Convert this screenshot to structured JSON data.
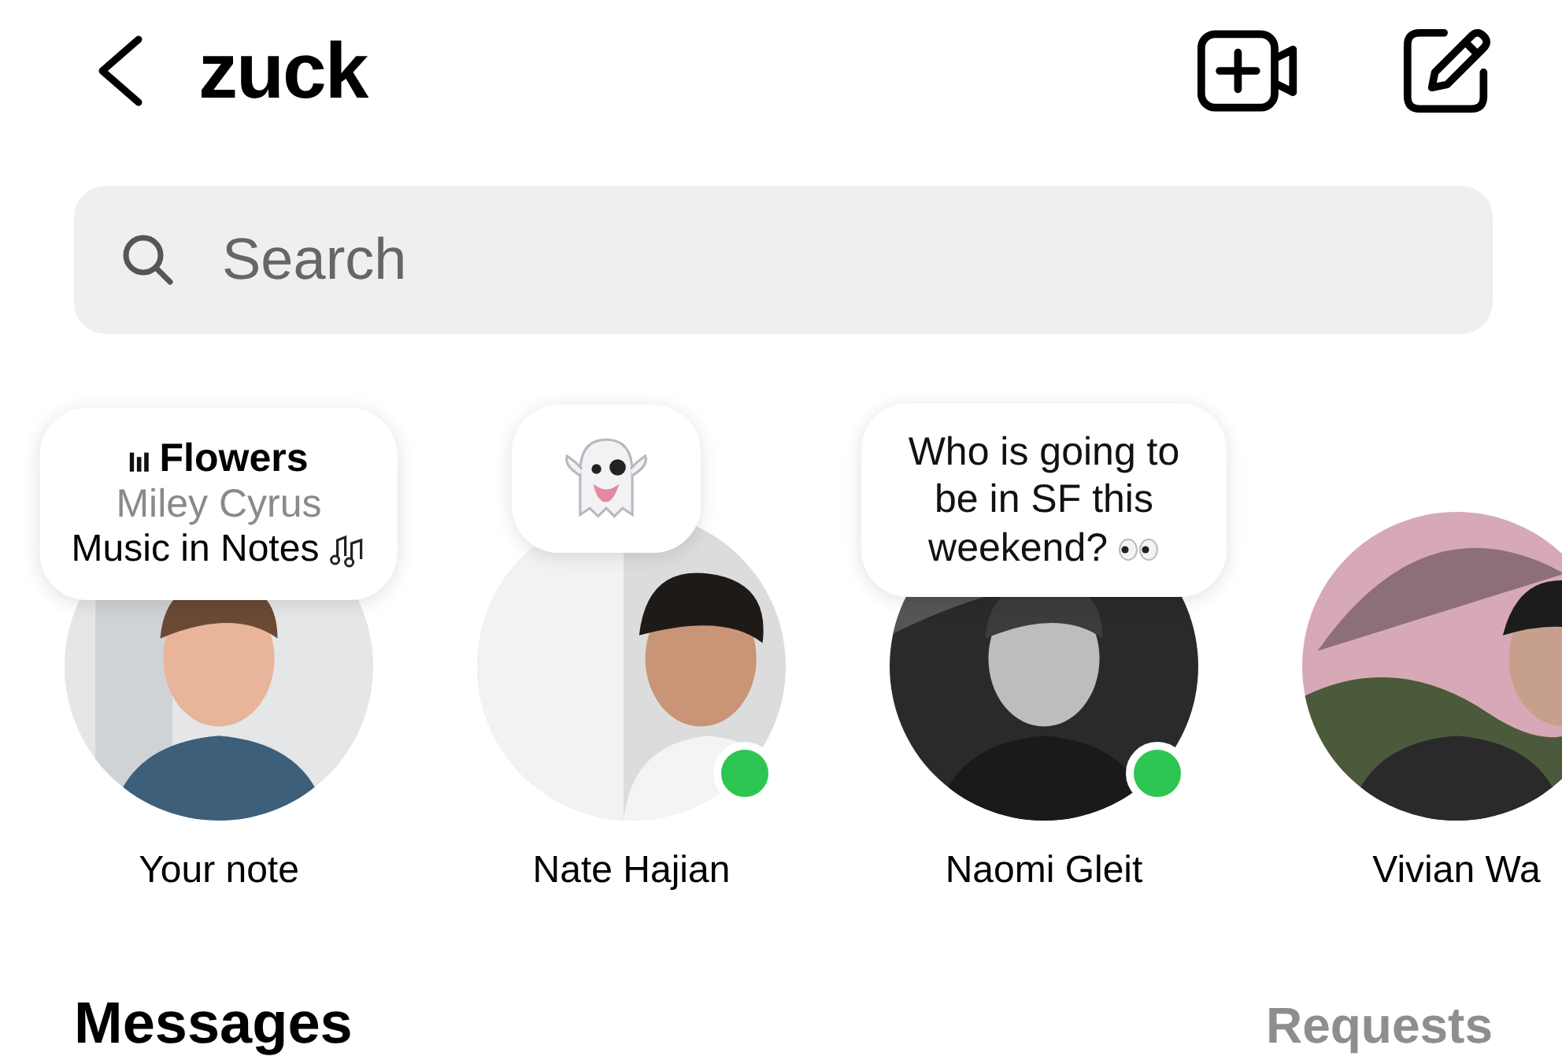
{
  "header": {
    "title": "zuck"
  },
  "search": {
    "placeholder": "Search"
  },
  "contacts": [
    {
      "name": "Your note",
      "online": false,
      "note": {
        "kind": "music",
        "song": "Flowers",
        "artist": "Miley Cyrus",
        "caption": "Music in Notes"
      }
    },
    {
      "name": "Nate Hajian",
      "online": true,
      "note": {
        "kind": "emoji"
      }
    },
    {
      "name": "Naomi Gleit",
      "online": true,
      "note": {
        "kind": "text",
        "text": "Who is going to be in SF this weekend?"
      }
    },
    {
      "name": "Vivian Wa",
      "online": false
    }
  ],
  "messages": {
    "title": "Messages",
    "requests": "Requests"
  }
}
